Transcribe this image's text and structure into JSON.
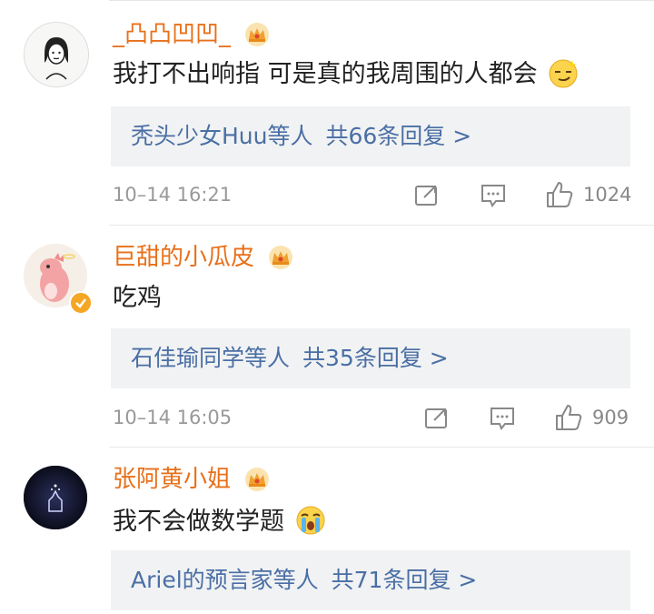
{
  "comments": [
    {
      "username": "_凸凸凹凹_",
      "text": "我打不出响指 可是真的我周围的人都会",
      "replies": {
        "names": "秃头少女Huu等人",
        "count": "共66条回复 >"
      },
      "time": "10–14 16:21",
      "likes": "1024"
    },
    {
      "username": "巨甜的小瓜皮",
      "text": "吃鸡",
      "replies": {
        "names": "石佳瑜同学等人",
        "count": "共35条回复 >"
      },
      "time": "10–14 16:05",
      "likes": "909"
    },
    {
      "username": "张阿黄小姐",
      "text": "我不会做数学题",
      "replies": {
        "names": "Ariel的预言家等人",
        "count": "共71条回复 >"
      }
    }
  ],
  "colors": {
    "username": "#e8701a",
    "reply_link": "#4a6fa5",
    "reply_bg": "#f1f2f3",
    "meta": "#999999",
    "verified_badge": "#f5a623"
  }
}
